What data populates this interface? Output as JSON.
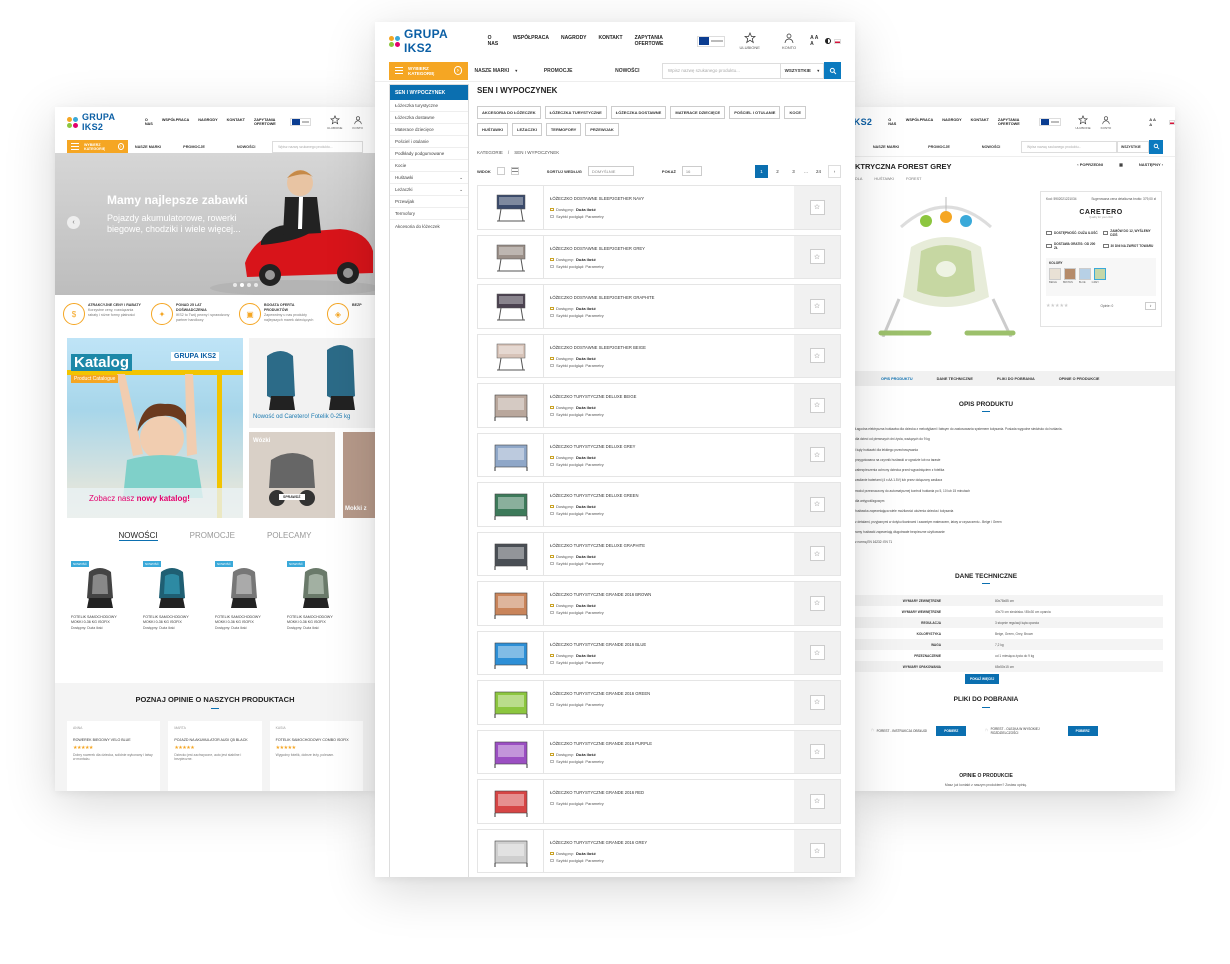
{
  "left": {
    "logo": {
      "text_a": "GRUPA ",
      "text_b": "IKS2"
    },
    "nav": [
      "O NAS",
      "WSPÓŁPRACA",
      "NAGRODY",
      "KONTAKT",
      "ZAPYTANIA OFERTOWE"
    ],
    "header_icons": {
      "fav": "ULUBIONE",
      "account": "KONTO"
    },
    "category_button": "WYBIERZ KATEGORIĘ",
    "sub_nav": [
      "NASZE MARKI",
      "PROMOCJE",
      "NOWOŚCI"
    ],
    "search_placeholder": "Wpisz nazwę szukanego produktu...",
    "hero": {
      "title": "Mamy najlepsze zabawki",
      "text": "Pojazdy akumulatorowe, rowerki biegowe, chodziki i wiele więcej..."
    },
    "features": [
      {
        "title": "ATRAKCYJNE CENY I RABATY",
        "text": "Korzystne ceny, rozwiązania rabaty i różne formy płatności"
      },
      {
        "title": "PONAD 25 LAT DOŚWIADCZENIA",
        "text": "IKS2 to Twój pewny i sprawdzony partner handlowy"
      },
      {
        "title": "BOGATA OFERTA PRODUKTÓW",
        "text": "Zapewnimy u nas produkty najlepszych marek dziecięcych"
      },
      {
        "title": "BEZP",
        "text": ""
      }
    ],
    "katalog": {
      "title": "Katalog",
      "sub": "Product Catalogue",
      "logo": "GRUPA IKS2",
      "call_a": "Zobacz nasz ",
      "call_b": "nowy katalog!"
    },
    "promo_a": "Nowość od Caretero! Fotelik 0-25 kg",
    "promo_b": "Wózki",
    "promo_c": "Mokki z",
    "promo_btn": "SPRAWDŹ",
    "tabs": [
      "NOWOŚCI",
      "PROMOCJE",
      "POLECAMY"
    ],
    "products": [
      {
        "badge": "NOWOŚĆ",
        "name": "FOTELIK SAMOCHODOWY MOKKI 0-36 KG ISOFIX",
        "avail": "Dostępny: Duża ilość"
      },
      {
        "badge": "NOWOŚĆ",
        "name": "FOTELIK SAMOCHODOWY MOKKI 0-36 KG ISOFIX",
        "avail": "Dostępny: Duża ilość"
      },
      {
        "badge": "NOWOŚĆ",
        "name": "FOTELIK SAMOCHODOWY MOKKI 0-36 KG ISOFIX",
        "avail": "Dostępny: Duża ilość"
      },
      {
        "badge": "NOWOŚĆ",
        "name": "FOTELIK SAMOCHODOWY MOKKI 0-36 KG ISOFIX",
        "avail": "Dostępny: Duża ilość"
      }
    ],
    "opinions_title": "POZNAJ OPINIE O NASZYCH PRODUKTACH",
    "opinions": [
      {
        "author": "ANNA",
        "product": "ROWEREK BIEGOWY VELO BLUE",
        "text": "Dobry rowerek dla dziecka, solidnie wykonany i łatwy w montażu."
      },
      {
        "author": "MARTA",
        "product": "POJAZD NA AKUMULATOR AUDI Q5 BLACK",
        "text": "Dziecko jest zachwycone, auto jest stabilne i bezpieczne."
      },
      {
        "author": "KASIA",
        "product": "FOTELIK SAMOCHODOWY COMBO ISOFIX",
        "text": "Wygodny fotelik, dobrze leży, polecam."
      }
    ]
  },
  "mid": {
    "logo": {
      "text_a": "GRUPA ",
      "text_b": "IKS2"
    },
    "nav": [
      "O NAS",
      "WSPÓŁPRACA",
      "NAGRODY",
      "KONTAKT",
      "ZAPYTANIA OFERTOWE"
    ],
    "header_icons": {
      "fav": "ULUBIONE",
      "account": "KONTO"
    },
    "font_sizes": "A A A",
    "category_button": "WYBIERZ KATEGORIĘ",
    "sub_nav": [
      "NASZE MARKI",
      "PROMOCJE",
      "NOWOŚCI"
    ],
    "search_placeholder": "Wpisz nazwę szukanego produktu...",
    "search_scope": "WSZYSTKIE",
    "sidebar": {
      "title": "SEN I WYPOCZYNEK",
      "items": [
        "Łóżeczka turystyczne",
        "Łóżeczka dostawne",
        "Materace dziecięce",
        "Pościel i otulanie",
        "Podkłady podgumowane",
        "Kocie",
        "Huśtawki",
        "Leżaczki",
        "Przewijak",
        "Termofory",
        "Akcesoria do łóżeczek"
      ]
    },
    "page_title": "SEN I WYPOCZYNEK",
    "chips": [
      "AKCESORIA DO ŁÓŻECZEK",
      "ŁÓŻECZKA TURYSTYCZNE",
      "ŁÓŻECZKA DOSTAWNE",
      "MATERACE DZIECIĘCE",
      "POŚCIEL I OTULANIE",
      "KOCE",
      "HUŚTAWKI",
      "LEŻACZKI",
      "TERMOFORY",
      "PRZEWIJAK"
    ],
    "breadcrumb": [
      "KATEGORIE",
      "/",
      "SEN I WYPOCZYNEK"
    ],
    "toolbar": {
      "view": "WIDOK",
      "sort": "SORTUJ WEDŁUG",
      "sort_value": "DOMYŚLNIE",
      "show": "POKAŻ",
      "show_value": "16"
    },
    "pagination": [
      "1",
      "2",
      "3",
      "...",
      "24",
      "›"
    ],
    "labels": {
      "avail": "Dostępny:",
      "avail_value": "Duża ilość",
      "details": "Szybki podgląd: Parametry"
    },
    "products": [
      {
        "name": "ŁÓŻECZKO DOSTAWNE SLEEP2GETHER NAVY",
        "color": "#3a4a6b",
        "avail": true
      },
      {
        "name": "ŁÓŻECZKO DOSTAWNE SLEEP2GETHER GREY",
        "color": "#9a8f88",
        "avail": true
      },
      {
        "name": "ŁÓŻECZKO DOSTAWNE SLEEP2GETHER GRAPHITE",
        "color": "#4b4250",
        "avail": true
      },
      {
        "name": "ŁÓŻECZKO DOSTAWNE SLEEP2GETHER BEIGE",
        "color": "#d7c3b8",
        "avail": true
      },
      {
        "name": "ŁÓŻECZKO TURYSTYCZNE DELUXE BEIGE",
        "color": "#b9a79c",
        "avail": true
      },
      {
        "name": "ŁÓŻECZKO TURYSTYCZNE DELUXE GREY",
        "color": "#8fa7c8",
        "avail": true
      },
      {
        "name": "ŁÓŻECZKO TURYSTYCZNE DELUXE GREEN",
        "color": "#3d7a5a",
        "avail": true
      },
      {
        "name": "ŁÓŻECZKO TURYSTYCZNE DELUXE GRAPHITE",
        "color": "#4a4f55",
        "avail": true
      },
      {
        "name": "ŁÓŻECZKO TURYSTYCZNE GRANDE 2016 BROWN",
        "color": "#c9845a",
        "avail": true
      },
      {
        "name": "ŁÓŻECZKO TURYSTYCZNE GRANDE 2016 BLUE",
        "color": "#2d8fd6",
        "avail": true
      },
      {
        "name": "ŁÓŻECZKO TURYSTYCZNE GRANDE 2016 GREEN",
        "color": "#8cc63f",
        "avail": false
      },
      {
        "name": "ŁÓŻECZKO TURYSTYCZNE GRANDE 2016 PURPLE",
        "color": "#9b4fc2",
        "avail": true
      },
      {
        "name": "ŁÓŻECZKO TURYSTYCZNE GRANDE 2016 RED",
        "color": "#d64545",
        "avail": false
      },
      {
        "name": "ŁÓŻECZKO TURYSTYCZNE GRANDE 2016 GREY",
        "color": "#cfcfcf",
        "avail": true
      }
    ]
  },
  "right": {
    "logo_text": "IKS2",
    "nav": [
      "O NAS",
      "WSPÓŁPRACA",
      "NAGRODY",
      "KONTAKT",
      "ZAPYTANIA OFERTOWE"
    ],
    "header_icons": {
      "fav": "ULUBIONE",
      "account": "KONTO"
    },
    "font_sizes": "A A A",
    "sub_nav": [
      "NASZE MARKI",
      "PROMOCJE",
      "NOWOŚCI"
    ],
    "search_placeholder": "Wpisz nazwę szukanego produktu...",
    "search_scope": "WSZYSTKIE",
    "product_title": "KTRYCZNA FOREST GREY",
    "prev": "‹ POPRZEDNI",
    "next": "NASTĘPNY ›",
    "breadcrumb": [
      "DLA",
      "HUŚTAWKI",
      "FOREST"
    ],
    "code": "Kod: 5902021221034",
    "price_note": "Sugerowana cena detaliczna brutto: 379,00 zł",
    "brand": "CARETERO",
    "brand_sub": "Quality for your child",
    "options": [
      "DOSTĘPNOŚĆ: DUŻA ILOŚĆ",
      "ZAMÓW DO 12, WYŚLEMY DZIŚ",
      "DOSTAWA GRATIS: OD 200 ZŁ",
      "30 DNI NA ZWROT TOWARU"
    ],
    "colors_label": "KOLORY",
    "swatches": [
      "BEIGE",
      "BROWN",
      "BLUE",
      "GREY"
    ],
    "rating": "Opinie: 0",
    "tabs": [
      "OPIS PRODUKTU",
      "DANE TECHNICZNE",
      "PLIKI DO POBRANIA",
      "OPINIE O PRODUKCIE"
    ],
    "opis_title": "OPIS PRODUKTU",
    "opis_lines": [
      "Łagodna elektryczna huśtawka dla dziecka z melodyjkami i łatwym do zastosowania systemem kołysania. Posiada wygodne siedzisko do huśtania.",
      "dla dzieci od pierwszych dni życia, ważących do 9 kg",
      "i kąty huśtawki dla lekkiego przechowywania",
      "przygotowana na czynnik huśtawki w ogrodzie lub na tarasie",
      "zabezpieczenia ochrony dziecka przed wypadnięciem z fotelika",
      "zasilanie bateriami (4 x AA 1.5V) lub przez dołączony zasilacz",
      "moduł przeznaczony do automatycznej kontroli huśtania po 5, 10 lub 15 minutach",
      "dla antypoślizgowym",
      "huśtawka zapewniająca wiele możliwości ułożenia dziecka i kołysania",
      "z detalami, przyjaznymi w dotyku tkaninami i zawartym materacem, łatwy w czyszczeniu - Beige i Green",
      "ramy huśtawki zapewniają długotrwałe bezpieczne użytkowanie",
      "z normą EN 16232: EN 71"
    ],
    "tech_title": "DANE TECHNICZNE",
    "tech": [
      {
        "k": "WYMIARY ZEWNĘTRZNE",
        "v": "80x78x85 cm"
      },
      {
        "k": "WYMIARY WEWNĘTRZNE",
        "v": "40x70 cm siedziska / 85x30 cm oparcia"
      },
      {
        "k": "REGULACJA",
        "v": "3 stopnie regulacji kąta oparcia"
      },
      {
        "k": "KOLORYSTYKA",
        "v": "Beige, Green, Grey, Brown"
      },
      {
        "k": "WAGA",
        "v": "7,2 kg"
      },
      {
        "k": "PRZEZNACZENIE",
        "v": "od 1 miesiąca życia do 9 kg"
      },
      {
        "k": "WYMIARY OPAKOWANIA",
        "v": "65x50x15 cm"
      }
    ],
    "more_btn": "POKAŻ WIĘCEJ",
    "files_title": "PLIKI DO POBRANIA",
    "files": [
      {
        "name": "FOREST - INSTRUKCJA OBSŁUGI",
        "btn": "POBIERZ"
      },
      {
        "name": "FOREST - OLEJKA W WYSOKIEJ ROZDZIELCZOŚCI",
        "btn": "POBIERZ"
      }
    ],
    "opinions_title": "OPINIE O PRODUKCIE",
    "opinions_text": "Masz już kontakt z naszym produktem? Zostaw opinię."
  }
}
